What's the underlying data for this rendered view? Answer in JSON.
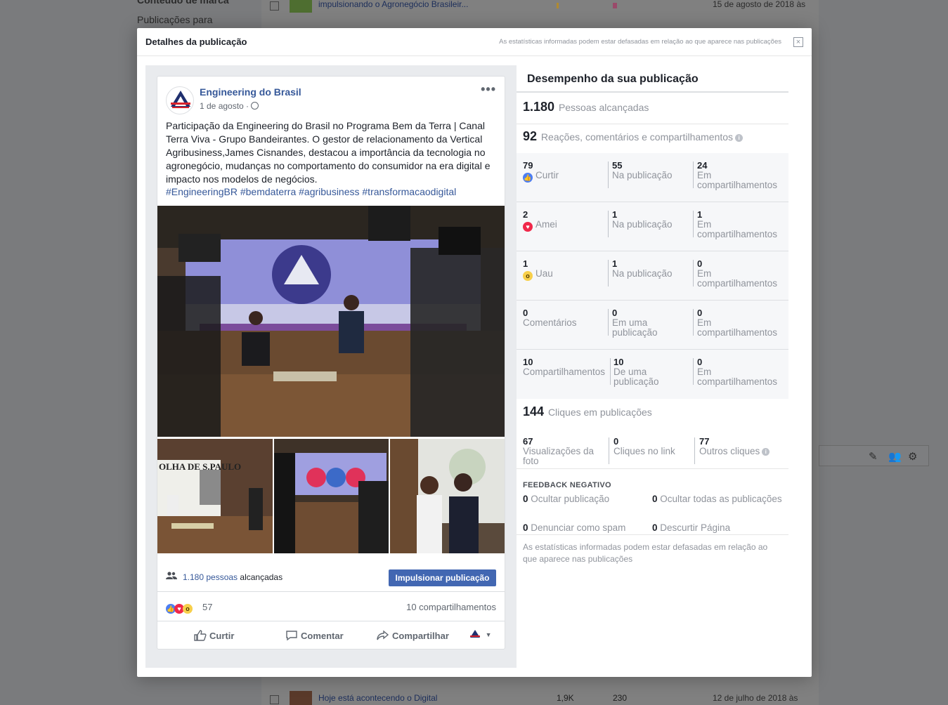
{
  "background": {
    "sidebar": [
      "Conteúdo de marca",
      "Publicações para"
    ],
    "top_row": {
      "title": "impulsionando o Agronegócio Brasileir...",
      "date": "15 de agosto de 2018 às"
    },
    "bottom_row": {
      "title": "Hoje está acontecendo o Digital",
      "reach": "1,9K",
      "engagement": "230",
      "date": "12 de julho de 2018 às"
    }
  },
  "modal": {
    "title": "Detalhes da publicação",
    "note": "As estatísticas informadas podem estar defasadas em relação ao que aparece nas publicações",
    "close": "×"
  },
  "post": {
    "page_name": "Engineering do Brasil",
    "date": "1 de agosto ·",
    "more": "•••",
    "text": "Participação da Engineering do Brasil no Programa Bem da Terra | Canal Terra Viva - Grupo Bandeirantes. O gestor de relacionamento da Vertical Agribusiness,James Cisnandes, destacou a importância da tecnologia no agronegócio, mudanças no comportamento do consumidor na era digital e impacto nos modelos de negócios.",
    "hashtags": "#EngineeringBR #bemdaterra #agribusiness #transformacaodigital",
    "reach_number": "1.180 pessoas",
    "reach_suffix": " alcançadas",
    "boost_label": "Impulsionar publicação",
    "reactions_count": "57",
    "shares_label": "10 compartilhamentos",
    "actions": {
      "like": "Curtir",
      "comment": "Comentar",
      "share": "Compartilhar"
    }
  },
  "performance": {
    "title": "Desempenho da sua publicação",
    "reach": {
      "value": "1.180",
      "label": "Pessoas alcançadas"
    },
    "engagement": {
      "value": "92",
      "label": "Reações, comentários e compartilhamentos"
    },
    "rows": [
      {
        "total": "79",
        "label": "Curtir",
        "icon": "like",
        "on_post": "55",
        "on_post_label": "Na publicação",
        "on_shares": "24",
        "on_shares_label": "Em compartilhamentos"
      },
      {
        "total": "2",
        "label": "Amei",
        "icon": "love",
        "on_post": "1",
        "on_post_label": "Na publicação",
        "on_shares": "1",
        "on_shares_label": "Em compartilhamentos"
      },
      {
        "total": "1",
        "label": "Uau",
        "icon": "wow",
        "on_post": "1",
        "on_post_label": "Na publicação",
        "on_shares": "0",
        "on_shares_label": "Em compartilhamentos"
      },
      {
        "total": "0",
        "label": "Comentários",
        "icon": "",
        "on_post": "0",
        "on_post_label": "Em uma publicação",
        "on_shares": "0",
        "on_shares_label": "Em compartilhamentos"
      },
      {
        "total": "10",
        "label": "Compartilhamentos",
        "icon": "",
        "on_post": "10",
        "on_post_label": "De uma publicação",
        "on_shares": "0",
        "on_shares_label": "Em compartilhamentos"
      }
    ],
    "clicks": {
      "value": "144",
      "label": "Cliques em publicações"
    },
    "click_breakdown": [
      {
        "value": "67",
        "label": "Visualizações da foto"
      },
      {
        "value": "0",
        "label": "Cliques no link"
      },
      {
        "value": "77",
        "label": "Outros cliques"
      }
    ],
    "negative_title": "FEEDBACK NEGATIVO",
    "negative": [
      {
        "value": "0",
        "label": "Ocultar publicação"
      },
      {
        "value": "0",
        "label": "Ocultar todas as publicações"
      },
      {
        "value": "0",
        "label": "Denunciar como spam"
      },
      {
        "value": "0",
        "label": "Descurtir Página"
      }
    ],
    "footnote": "As estatísticas informadas podem estar defasadas em relação ao que aparece nas publicações"
  },
  "colors": {
    "brand_blue": "#4267b2",
    "link": "#365899",
    "like": "#4c7ef3",
    "love": "#f0284a",
    "wow": "#f7cf4a"
  }
}
